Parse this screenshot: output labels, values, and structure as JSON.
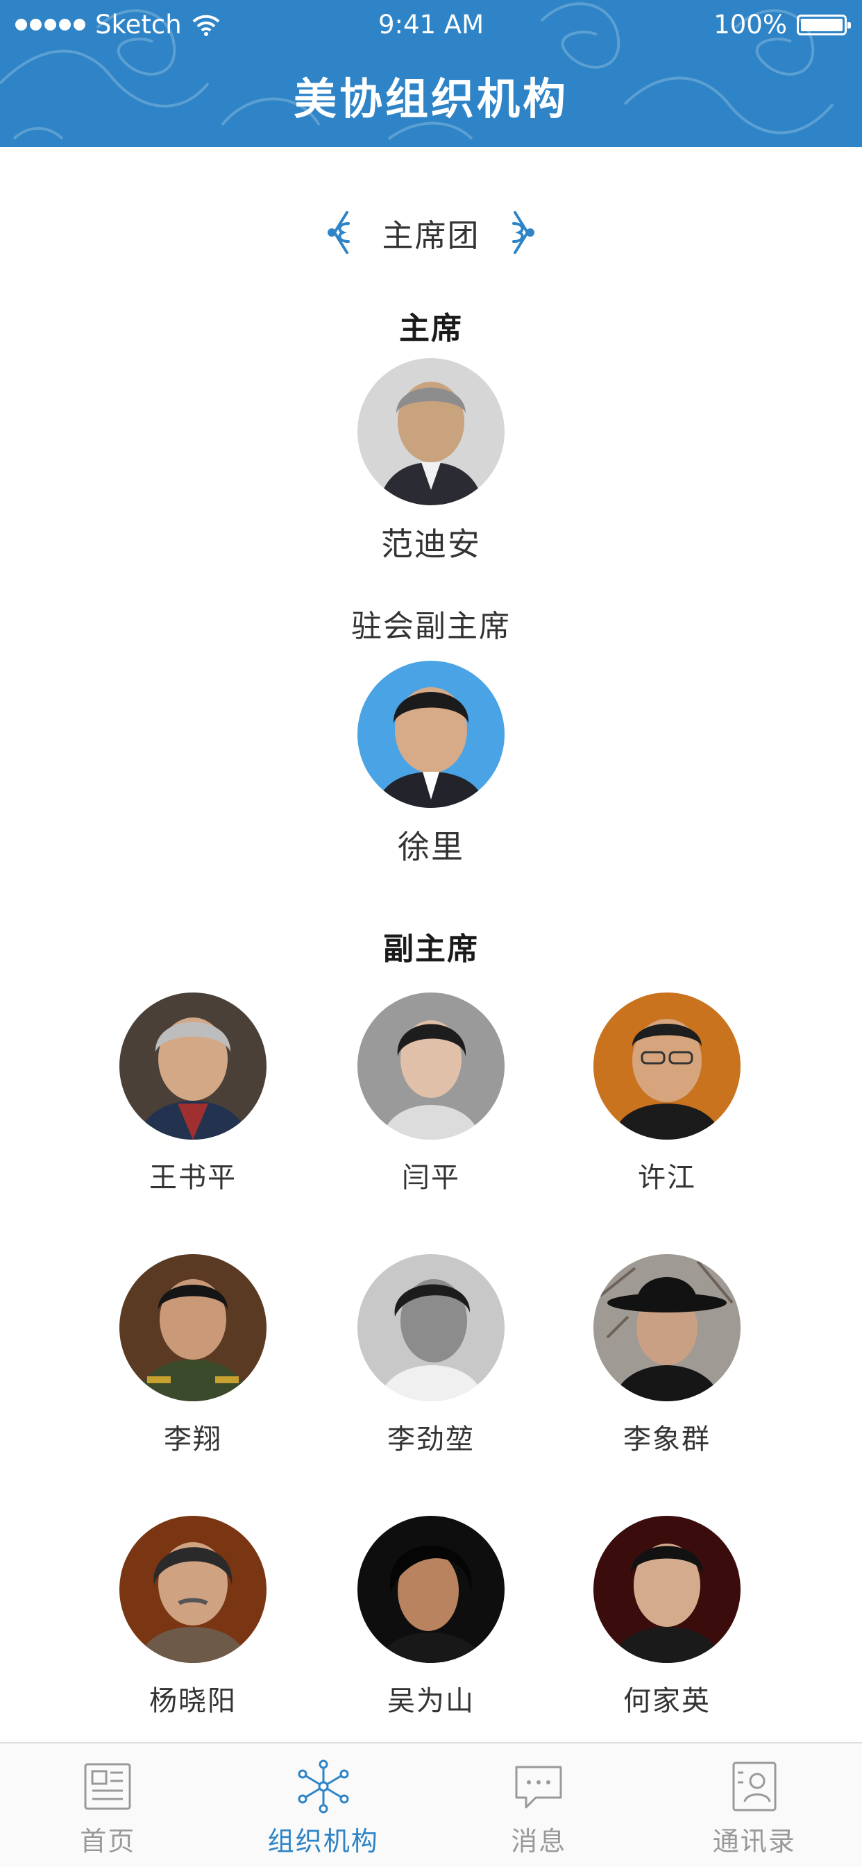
{
  "status_bar": {
    "carrier": "Sketch",
    "time": "9:41 AM",
    "battery": "100%"
  },
  "header": {
    "title": "美协组织机构"
  },
  "section": {
    "title": "主席团"
  },
  "chairman": {
    "role": "主席",
    "person": {
      "name": "范迪安"
    }
  },
  "resident_vice_chairman": {
    "role": "驻会副主席",
    "person": {
      "name": "徐里"
    }
  },
  "vice_chairmen": {
    "role": "副主席",
    "people": [
      {
        "name": "王书平"
      },
      {
        "name": "闫平"
      },
      {
        "name": "许江"
      },
      {
        "name": "李翔"
      },
      {
        "name": "李劲堃"
      },
      {
        "name": "李象群"
      },
      {
        "name": "杨晓阳"
      },
      {
        "name": "吴为山"
      },
      {
        "name": "何家英"
      }
    ]
  },
  "tabbar": {
    "tabs": [
      {
        "label": "首页",
        "icon": "news-icon"
      },
      {
        "label": "组织机构",
        "icon": "network-icon",
        "active": true
      },
      {
        "label": "消息",
        "icon": "message-icon"
      },
      {
        "label": "通讯录",
        "icon": "contacts-icon"
      }
    ]
  },
  "colors": {
    "brand": "#2e84c6"
  }
}
